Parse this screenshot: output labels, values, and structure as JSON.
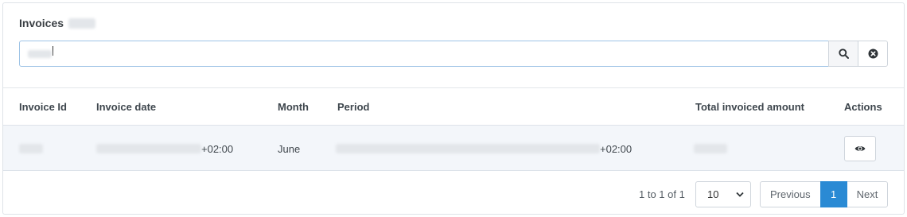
{
  "panel": {
    "title": "Invoices"
  },
  "search": {
    "value": "",
    "search_icon": "search-icon",
    "clear_icon": "clear-icon"
  },
  "table": {
    "columns": [
      "Invoice Id",
      "Invoice date",
      "Month",
      "Period",
      "Total invoiced amount",
      "Actions"
    ],
    "rows": [
      {
        "invoice_date_suffix": "+02:00",
        "month": "June",
        "period_suffix": "+02:00",
        "action_icon": "eye-icon"
      }
    ]
  },
  "pagination": {
    "range_text": "1 to 1 of 1",
    "page_size": "10",
    "previous_label": "Previous",
    "current_page": "1",
    "next_label": "Next"
  },
  "colors": {
    "accent": "#2a8ad4",
    "row_bg": "#f3f6fa",
    "input_focus_border": "#9ec3e6"
  }
}
